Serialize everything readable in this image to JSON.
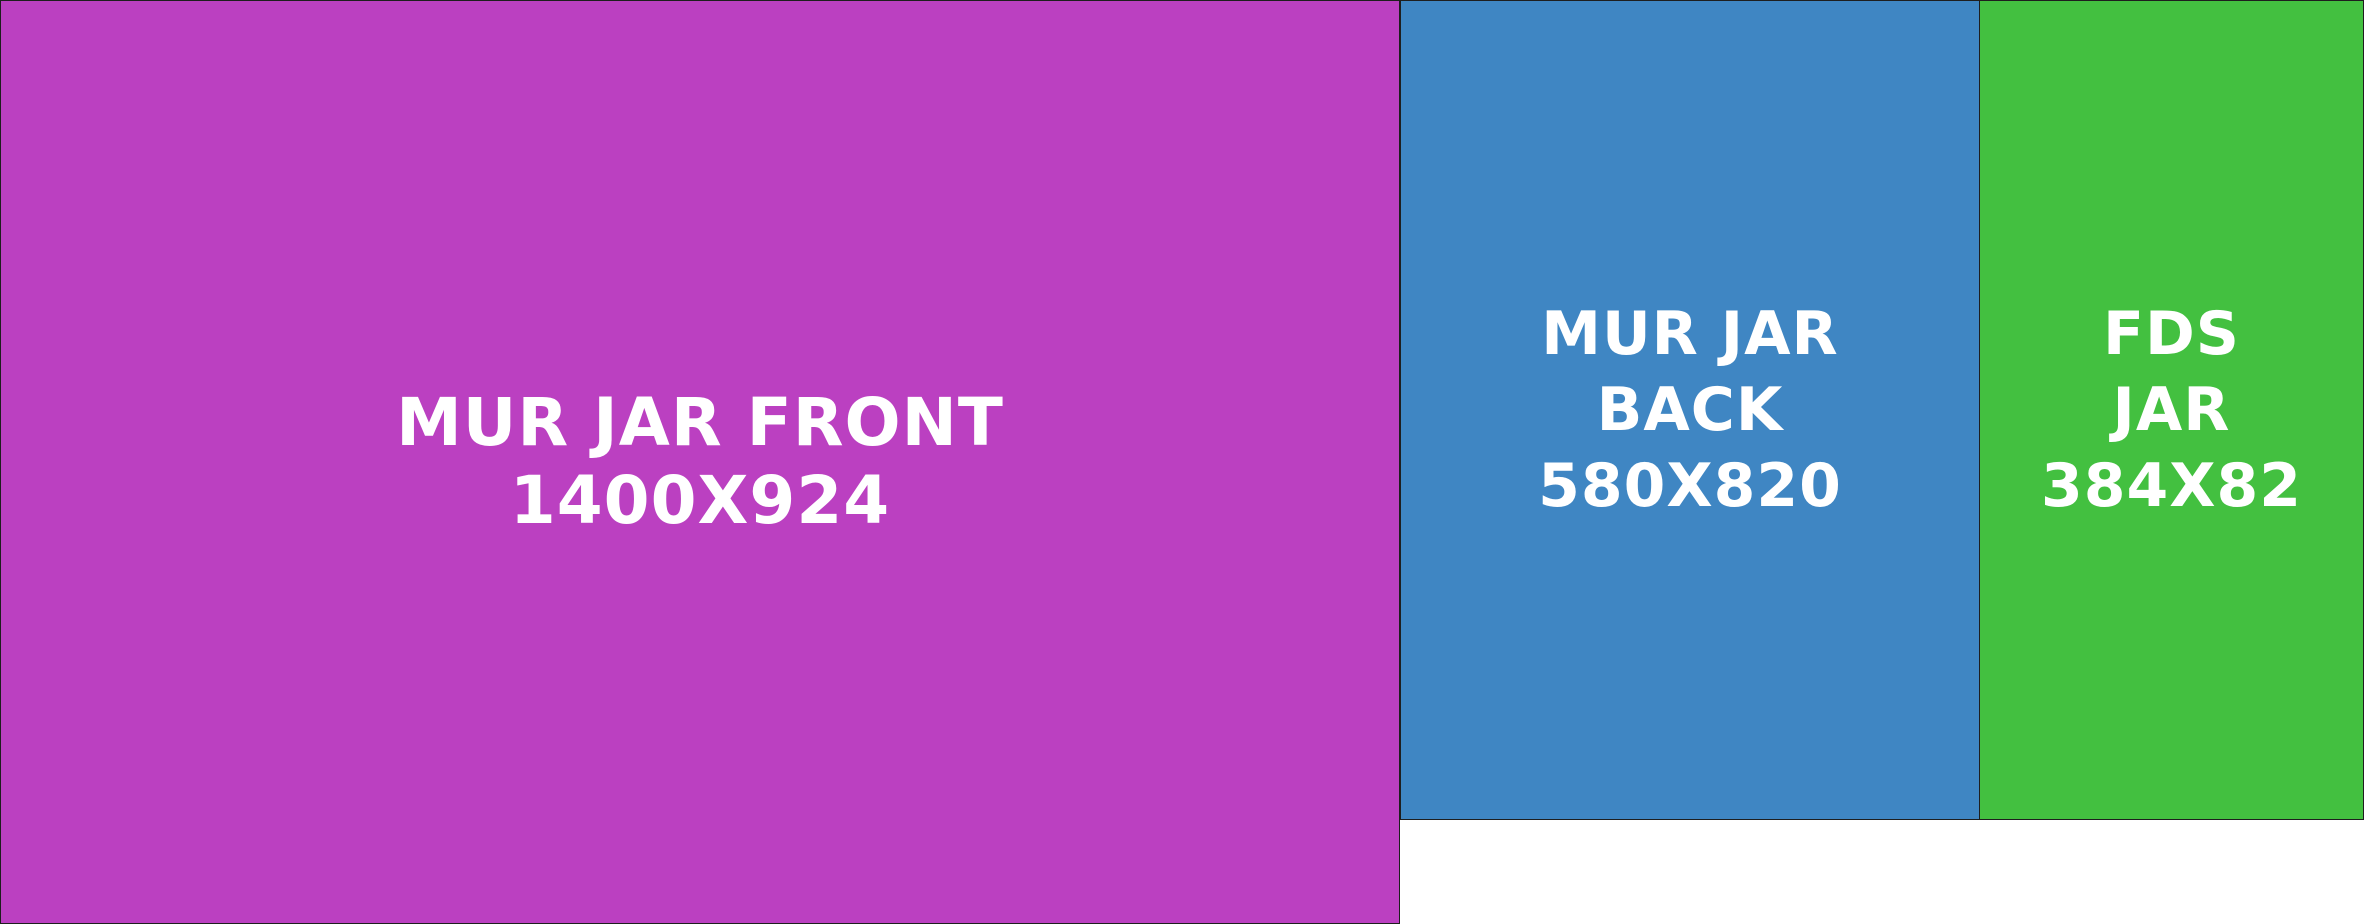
{
  "panels": {
    "front": {
      "color": "#bb40c1",
      "line1": "MUR JAR FRONT",
      "line2": "1400X924"
    },
    "back": {
      "color": "#3f86c3",
      "line1": "MUR JAR",
      "line2": "BACK",
      "line3": "580X820"
    },
    "fds": {
      "color": "#43c040",
      "line1": "FDS",
      "line2": "JAR",
      "line3": "384X82"
    }
  },
  "background": "#ffffff",
  "border_color": "#1e1e1e"
}
